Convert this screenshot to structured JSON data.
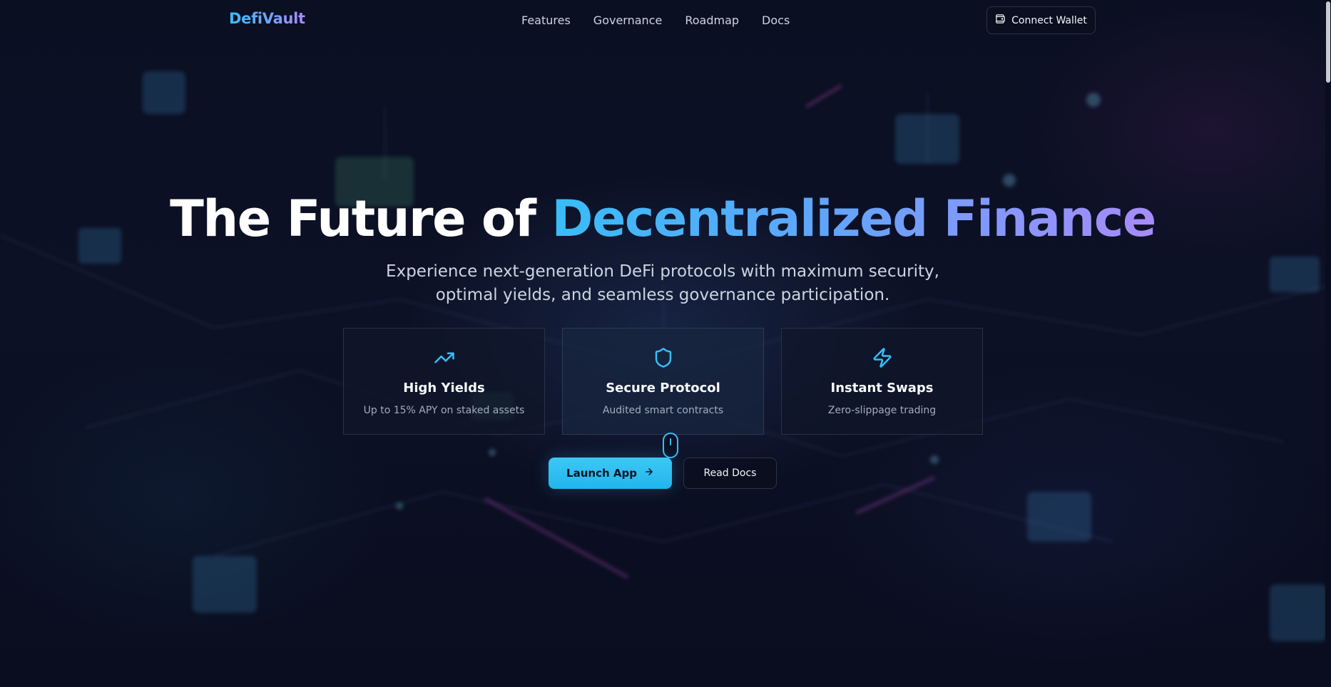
{
  "nav": {
    "logo": "DefiVault",
    "links": [
      "Features",
      "Governance",
      "Roadmap",
      "Docs"
    ],
    "connect_wallet_label": "Connect Wallet",
    "connect_wallet_icon": "wallet-icon"
  },
  "hero": {
    "title_plain": "The Future of ",
    "title_highlight": "Decentralized Finance",
    "subtitle": "Experience next-generation DeFi protocols with maximum security, optimal yields, and seamless governance participation."
  },
  "features": [
    {
      "icon": "trending-up-icon",
      "title": "High Yields",
      "description": "Up to 15% APY on staked assets"
    },
    {
      "icon": "shield-icon",
      "title": "Secure Protocol",
      "description": "Audited smart contracts"
    },
    {
      "icon": "lightning-icon",
      "title": "Instant Swaps",
      "description": "Zero-slippage trading"
    }
  ],
  "cta": {
    "launch_label": "Launch App",
    "launch_icon": "arrow-right-icon",
    "docs_label": "Read Docs"
  },
  "scroll_indicator_icon": "mouse-scroll-icon",
  "colors": {
    "accent": "#38bdf8",
    "accent_secondary": "#a78bfa",
    "background": "#0a0d1d"
  }
}
